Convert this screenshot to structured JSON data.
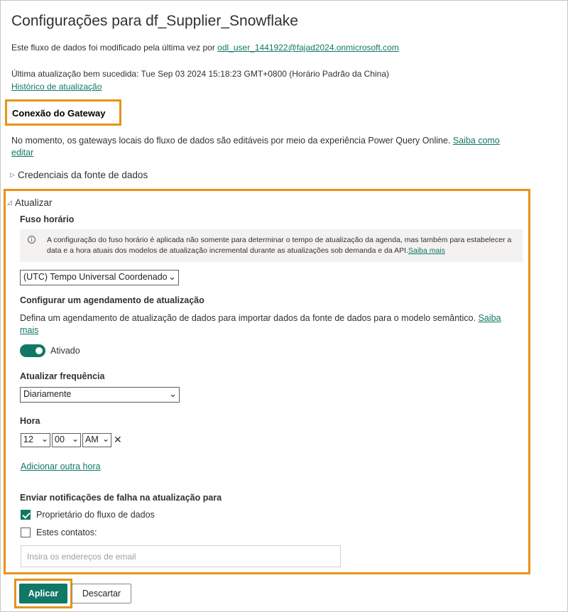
{
  "header": {
    "title": "Configurações para df_Supplier_Snowflake",
    "modified_prefix": "Este fluxo de dados foi modificado pela última vez por ",
    "modified_user": "odl_user_1441922@fajad2024.onmicrosoft.com",
    "last_update": "Última atualização bem sucedida: Tue Sep 03 2024 15:18:23 GMT+0800 (Horário Padrão da China)",
    "history_link": "Histórico de atualização"
  },
  "gateway": {
    "heading": "Conexão do Gateway",
    "text": "No momento, os gateways locais do fluxo de dados são editáveis por meio da experiência Power Query Online. ",
    "link": "Saiba como editar"
  },
  "credentials": {
    "label": "Credenciais da fonte de dados",
    "icon": "triangle-right-icon"
  },
  "refresh": {
    "label": "Atualizar",
    "icon": "triangle-down-icon",
    "timezone_label": "Fuso horário",
    "timezone_info": "A configuração do fuso horário é aplicada não somente para determinar o tempo de atualização da agenda, mas também para estabelecer a data e a hora atuais dos modelos de atualização incremental durante as atualizações sob demanda e da API.",
    "timezone_info_link": "Saiba mais",
    "timezone_value": "(UTC) Tempo Universal Coordenado",
    "schedule_heading": "Configurar um agendamento de atualização",
    "schedule_text": "Defina um agendamento de atualização de dados para importar dados da fonte de dados para o modelo semântico. ",
    "schedule_link": "Saiba mais",
    "toggle_label": "Ativado",
    "toggle_on": true,
    "frequency_label": "Atualizar frequência",
    "frequency_value": "Diariamente",
    "time_label": "Hora",
    "time_hour": "12",
    "time_minute": "00",
    "time_ampm": "AM",
    "add_time_link": "Adicionar outra hora",
    "notify_heading": "Enviar notificações de falha na atualização para",
    "notify_owner_label": "Proprietário do fluxo de dados",
    "notify_owner_checked": true,
    "notify_contacts_label": "Estes contatos:",
    "notify_contacts_checked": false,
    "email_placeholder": "Insira os endereços de email"
  },
  "actions": {
    "apply": "Aplicar",
    "discard": "Descartar"
  },
  "colors": {
    "accent": "#117865",
    "highlight": "#e8921a"
  }
}
